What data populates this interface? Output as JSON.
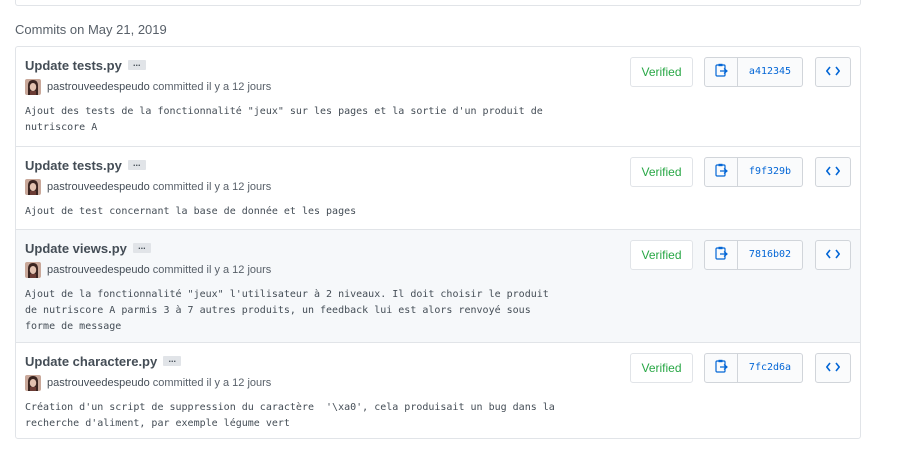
{
  "group_title": "Commits on May 21, 2019",
  "colors": {
    "link": "#0366d6",
    "verified": "#28a745",
    "border": "#e1e4e8"
  },
  "commits": [
    {
      "title": "Update tests.py",
      "ellipsis": "...",
      "author": "pastrouveedespeudo",
      "verb": "committed",
      "ago": "il y a 12 jours",
      "description": "Ajout des tests de la fonctionnalité \"jeux\" sur les pages et la sortie d'un produit de\nnutriscore A",
      "verified": "Verified",
      "sha": "a412345",
      "copy_icon": "clipboard-icon",
      "browse_icon": "code-icon"
    },
    {
      "title": "Update tests.py",
      "ellipsis": "...",
      "author": "pastrouveedespeudo",
      "verb": "committed",
      "ago": "il y a 12 jours",
      "description": "Ajout de test concernant la base de donnée et les pages",
      "verified": "Verified",
      "sha": "f9f329b",
      "copy_icon": "clipboard-icon",
      "browse_icon": "code-icon"
    },
    {
      "title": "Update views.py",
      "ellipsis": "...",
      "author": "pastrouveedespeudo",
      "verb": "committed",
      "ago": "il y a 12 jours",
      "description": "Ajout de la fonctionnalité \"jeux\" l'utilisateur à 2 niveaux. Il doit choisir le produit\nde nutriscore A parmis 3 à 7 autres produits, un feedback lui est alors renvoyé sous\nforme de message",
      "verified": "Verified",
      "sha": "7816b02",
      "copy_icon": "clipboard-icon",
      "browse_icon": "code-icon"
    },
    {
      "title": "Update charactere.py",
      "ellipsis": "...",
      "author": "pastrouveedespeudo",
      "verb": "committed",
      "ago": "il y a 12 jours",
      "description": "Création d'un script de suppression du caractère  '\\xa0', cela produisait un bug dans la\nrecherche d'aliment, par exemple légume vert",
      "verified": "Verified",
      "sha": "7fc2d6a",
      "copy_icon": "clipboard-icon",
      "browse_icon": "code-icon"
    }
  ]
}
